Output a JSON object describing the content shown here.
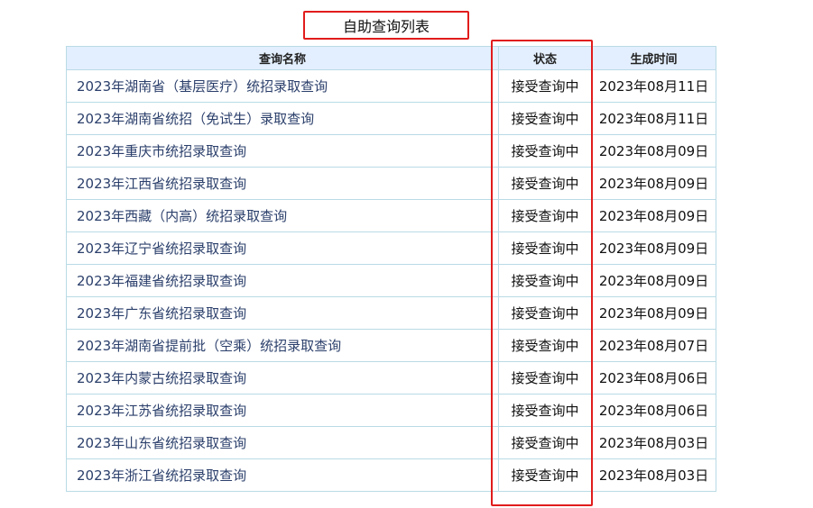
{
  "page": {
    "title": "自助查询列表"
  },
  "table": {
    "headers": {
      "name": "查询名称",
      "status": "状态",
      "date": "生成时间"
    },
    "rows": [
      {
        "name": "2023年湖南省（基层医疗）统招录取查询",
        "status": "接受查询中",
        "date": "2023年08月11日"
      },
      {
        "name": "2023年湖南省统招（免试生）录取查询",
        "status": "接受查询中",
        "date": "2023年08月11日"
      },
      {
        "name": "2023年重庆市统招录取查询",
        "status": "接受查询中",
        "date": "2023年08月09日"
      },
      {
        "name": "2023年江西省统招录取查询",
        "status": "接受查询中",
        "date": "2023年08月09日"
      },
      {
        "name": "2023年西藏（内高）统招录取查询",
        "status": "接受查询中",
        "date": "2023年08月09日"
      },
      {
        "name": "2023年辽宁省统招录取查询",
        "status": "接受查询中",
        "date": "2023年08月09日"
      },
      {
        "name": "2023年福建省统招录取查询",
        "status": "接受查询中",
        "date": "2023年08月09日"
      },
      {
        "name": "2023年广东省统招录取查询",
        "status": "接受查询中",
        "date": "2023年08月09日"
      },
      {
        "name": "2023年湖南省提前批（空乘）统招录取查询",
        "status": "接受查询中",
        "date": "2023年08月07日"
      },
      {
        "name": "2023年内蒙古统招录取查询",
        "status": "接受查询中",
        "date": "2023年08月06日"
      },
      {
        "name": "2023年江苏省统招录取查询",
        "status": "接受查询中",
        "date": "2023年08月06日"
      },
      {
        "name": "2023年山东省统招录取查询",
        "status": "接受查询中",
        "date": "2023年08月03日"
      },
      {
        "name": "2023年浙江省统招录取查询",
        "status": "接受查询中",
        "date": "2023年08月03日"
      }
    ]
  },
  "colors": {
    "highlight": "#e11c1c",
    "header_bg": "#e3efff",
    "border": "#b9dbe6",
    "link_text": "#2b3f6b"
  }
}
